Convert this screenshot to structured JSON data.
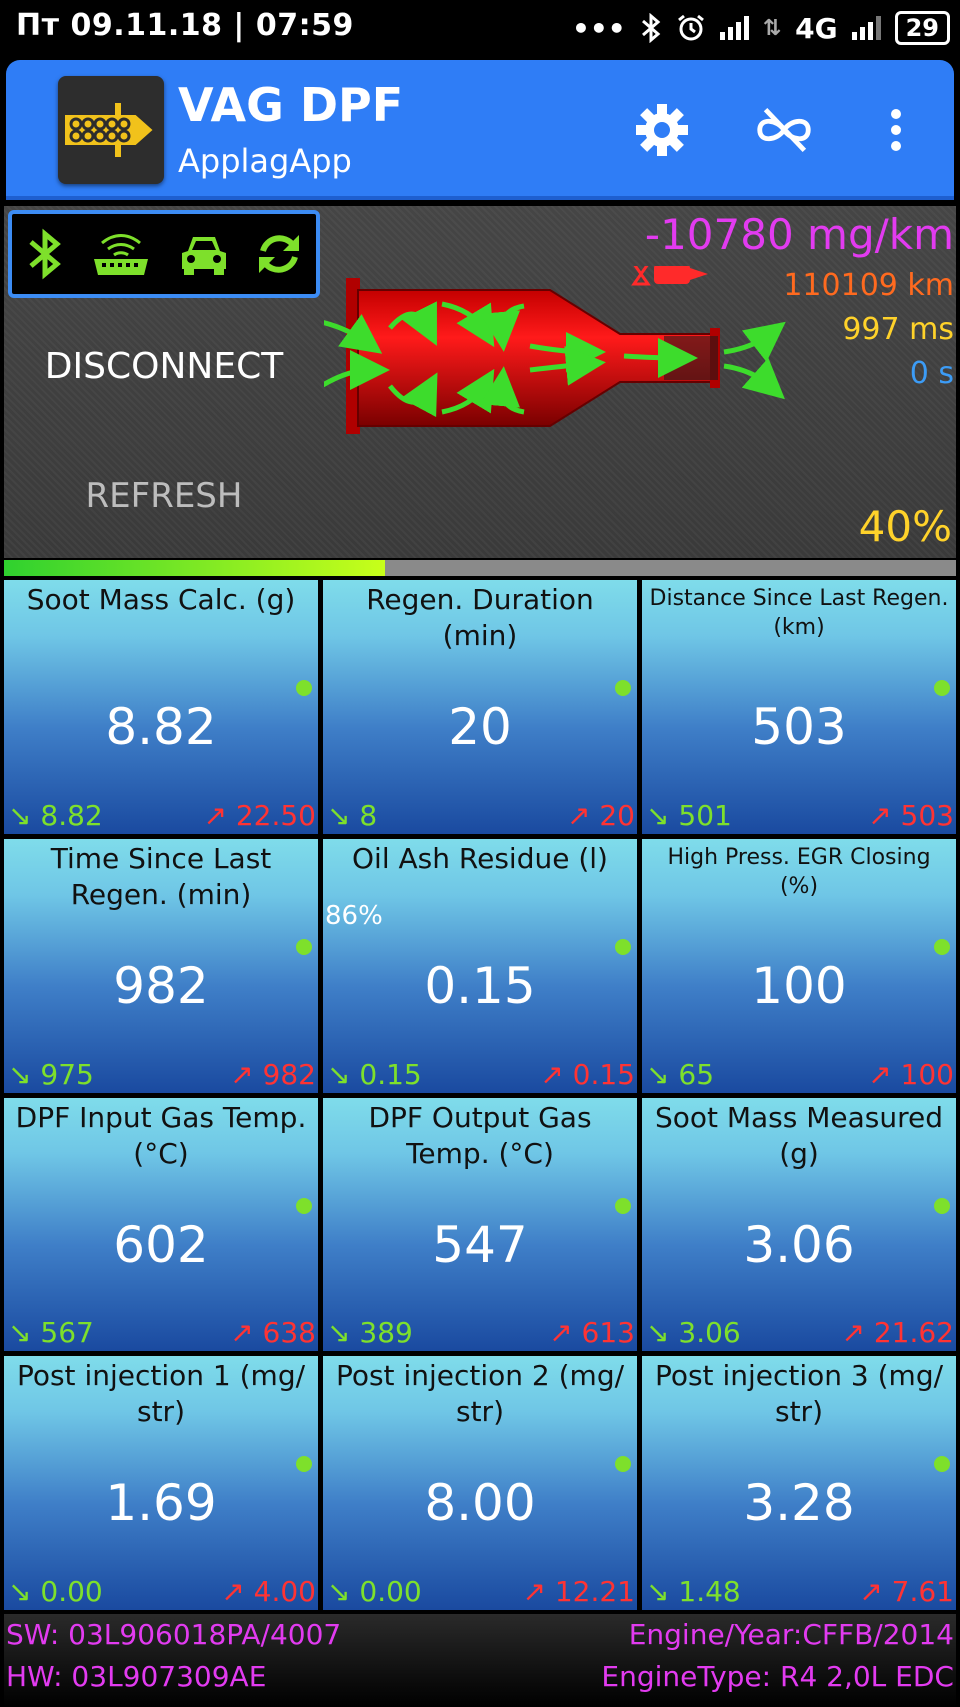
{
  "status_bar": {
    "datetime": "Пт 09.11.18 | 07:59",
    "network": "4G",
    "battery": "29",
    "icons": [
      "dots-icon",
      "bluetooth-icon",
      "alarm-icon",
      "signal-icon",
      "data-arrows-icon",
      "signal-icon-2",
      "battery-icon"
    ]
  },
  "app_bar": {
    "title": "VAG DPF",
    "subtitle": "ApplagApp",
    "icons": [
      "app-logo-icon",
      "settings-icon",
      "infinity-off-icon",
      "more-vert-icon"
    ]
  },
  "header": {
    "connection_icons": [
      "bluetooth-icon",
      "obd-connector-icon",
      "car-icon",
      "refresh-cycle-icon"
    ],
    "disconnect_label": "DISCONNECT",
    "refresh_label": "REFRESH",
    "soot_rate": "-10780 mg/km",
    "odometer": "110109 km",
    "latency": "997 ms",
    "timer": "0 s",
    "percent": "40%",
    "progress": 0.4
  },
  "tiles": [
    {
      "title": "Soot Mass Calc. (g)",
      "value": "8.82",
      "min": "8.82",
      "max": "22.50",
      "small": false,
      "pct": ""
    },
    {
      "title": "Regen. Duration (min)",
      "value": "20",
      "min": "8",
      "max": "20",
      "small": false,
      "pct": ""
    },
    {
      "title": "Distance Since Last Regen. (km)",
      "value": "503",
      "min": "501",
      "max": "503",
      "small": true,
      "pct": ""
    },
    {
      "title": "Time Since Last Regen. (min)",
      "value": "982",
      "min": "975",
      "max": "982",
      "small": false,
      "pct": ""
    },
    {
      "title": "Oil Ash Residue (l)",
      "value": "0.15",
      "min": "0.15",
      "max": "0.15",
      "small": false,
      "pct": "86%"
    },
    {
      "title": "High Press. EGR Closing (%)",
      "value": "100",
      "min": "65",
      "max": "100",
      "small": true,
      "pct": ""
    },
    {
      "title": "DPF Input Gas Temp. (°C)",
      "value": "602",
      "min": "567",
      "max": "638",
      "small": false,
      "pct": ""
    },
    {
      "title": "DPF Output Gas Temp. (°C)",
      "value": "547",
      "min": "389",
      "max": "613",
      "small": false,
      "pct": ""
    },
    {
      "title": "Soot Mass Measured (g)",
      "value": "3.06",
      "min": "3.06",
      "max": "21.62",
      "small": false,
      "pct": ""
    },
    {
      "title": "Post injection 1 (mg/ str)",
      "value": "1.69",
      "min": "0.00",
      "max": "4.00",
      "small": false,
      "pct": ""
    },
    {
      "title": "Post injection 2 (mg/ str)",
      "value": "8.00",
      "min": "0.00",
      "max": "12.21",
      "small": false,
      "pct": ""
    },
    {
      "title": "Post injection 3 (mg/ str)",
      "value": "3.28",
      "min": "1.48",
      "max": "7.61",
      "small": false,
      "pct": ""
    }
  ],
  "footer": {
    "sw": "SW: 03L906018PA/4007",
    "hw": "HW: 03L907309AE",
    "engine_year": "Engine/Year:CFFB/2014",
    "engine_type": "EngineType: R4 2,0L EDC"
  },
  "colors": {
    "accent": "#2f7df6",
    "green": "#7ee02b",
    "red": "#ff3333",
    "magenta": "#e23bf0",
    "orange": "#ff6a1f",
    "yellow": "#ffd22a",
    "blue": "#3c9cf6"
  }
}
